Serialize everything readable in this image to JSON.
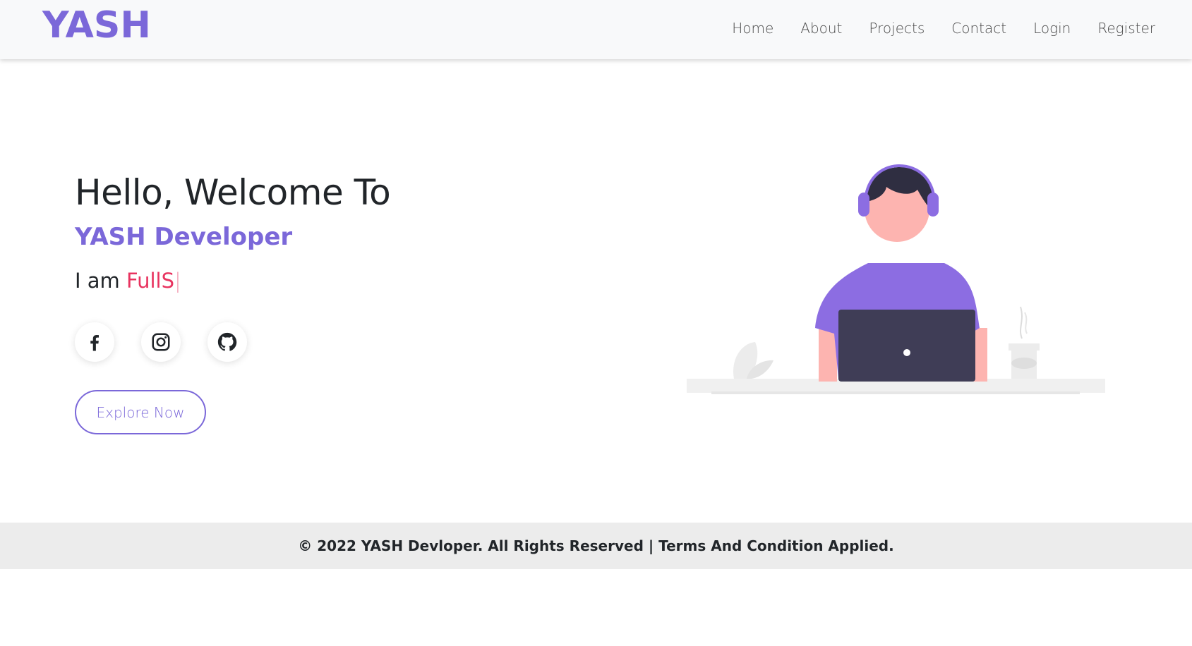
{
  "nav": {
    "brand": "YASH",
    "links": [
      "Home",
      "About",
      "Projects",
      "Contact",
      "Login",
      "Register"
    ]
  },
  "hero": {
    "title": "Hello, Welcome To",
    "subtitle": "YASH Developer",
    "role_prefix": "I am",
    "role_typed": "FullS",
    "cursor": "|",
    "socials": [
      "facebook-icon",
      "instagram-icon",
      "github-icon"
    ],
    "cta_label": "Explore Now"
  },
  "footer": {
    "text": "© 2022 YASH Devloper. All Rights Reserved | Terms And Condition Applied."
  },
  "colors": {
    "accent": "#7b68d9",
    "typed": "#e8335f",
    "footer_bg": "#ececec",
    "nav_bg": "#f8f9fa"
  }
}
